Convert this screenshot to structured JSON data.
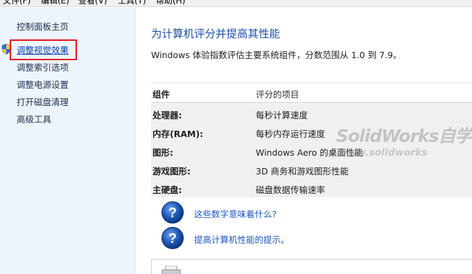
{
  "menubar": {
    "items": [
      "文件(F)",
      "编辑(E)",
      "查看(V)",
      "工具(T)",
      "帮助(H)"
    ]
  },
  "sidebar": {
    "items": [
      {
        "label": "控制面板主页",
        "active": false
      },
      {
        "label": "调整视觉效果",
        "active": true,
        "icon": "uac-shield-icon"
      },
      {
        "label": "调整索引选项",
        "active": false
      },
      {
        "label": "调整电源设置",
        "active": false
      },
      {
        "label": "打开磁盘清理",
        "active": false
      },
      {
        "label": "高级工具",
        "active": false
      }
    ]
  },
  "main": {
    "title": "为计算机评分并提高其性能",
    "description": "Windows 体验指数评估主要系统组件，分数范围从 1.0 到 7.9。",
    "table": {
      "headers": [
        "组件",
        "评分的项目"
      ],
      "rows": [
        [
          "处理器:",
          "每秒计算速度"
        ],
        [
          "内存(RAM):",
          "每秒内存运行速度"
        ],
        [
          "图形:",
          "Windows Aero 的桌面性能"
        ],
        [
          "游戏图形:",
          "3D 商务和游戏图形性能"
        ],
        [
          "主硬盘:",
          "磁盘数据传输速率"
        ]
      ]
    },
    "help_links": [
      {
        "label": "这些数字意味着什么?",
        "icon": "help-question-icon"
      },
      {
        "label": "提高计算机性能的提示。",
        "icon": "help-question-icon"
      }
    ]
  },
  "watermark": {
    "line1": "SolidWorks自学网",
    "line2": "www.solidworks"
  },
  "colors": {
    "sidebar_bg": "#eef4fb",
    "title": "#1d52a8",
    "link": "#1a56c4",
    "highlight_box": "#e0161c",
    "table_rows_bg": "#f0f0f0"
  }
}
